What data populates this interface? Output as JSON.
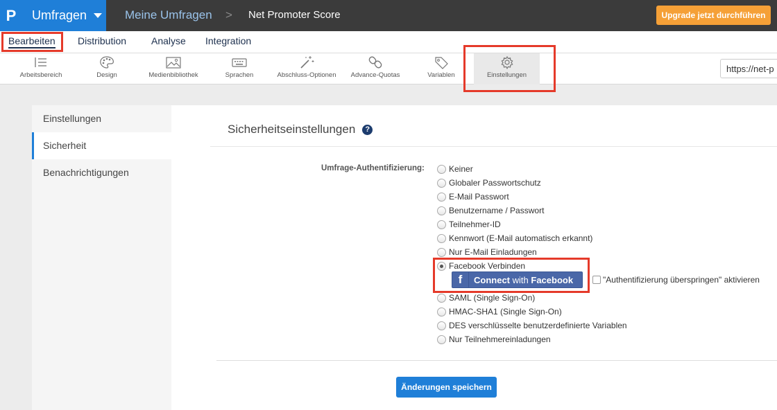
{
  "app": {
    "name": "Umfragen",
    "logo": "P"
  },
  "breadcrumb": {
    "parent": "Meine Umfragen",
    "separator": ">",
    "current": "Net Promoter Score"
  },
  "upgrade_label": "Upgrade jetzt durchführen",
  "nav_tabs": [
    {
      "label": "Bearbeiten",
      "active": true
    },
    {
      "label": "Distribution"
    },
    {
      "label": "Analyse"
    },
    {
      "label": "Integration"
    }
  ],
  "toolbar": {
    "items": [
      {
        "label": "Arbeitsbereich",
        "icon": "list-icon"
      },
      {
        "label": "Design",
        "icon": "palette-icon"
      },
      {
        "label": "Medienbibliothek",
        "icon": "image-icon"
      },
      {
        "label": "Sprachen",
        "icon": "keyboard-icon"
      },
      {
        "label": "Abschluss-Optionen",
        "icon": "magic-wand-icon"
      },
      {
        "label": "Advance-Quotas",
        "icon": "link-icon"
      },
      {
        "label": "Variablen",
        "icon": "tag-icon"
      },
      {
        "label": "Einstellungen",
        "icon": "gear-icon",
        "active": true
      }
    ],
    "url": "https://net-p"
  },
  "sidebar": {
    "items": [
      {
        "label": "Einstellungen"
      },
      {
        "label": "Sicherheit",
        "active": true
      },
      {
        "label": "Benachrichtigungen"
      }
    ]
  },
  "main": {
    "title": "Sicherheitseinstellungen",
    "help": "?",
    "auth_label": "Umfrage-Authentifizierung:",
    "options": [
      "Keiner",
      "Globaler Passwortschutz",
      "E-Mail Passwort",
      "Benutzername / Passwort",
      "Teilnehmer-ID",
      "Kennwort (E-Mail automatisch erkannt)",
      "Nur E-Mail Einladungen",
      "Facebook Verbinden",
      "SAML (Single Sign-On)",
      "HMAC-SHA1 (Single Sign-On)",
      "DES verschlüsselte benutzerdefinierte Variablen",
      "Nur Teilnehmereinladungen"
    ],
    "selected_option": "Facebook Verbinden",
    "facebook_button": {
      "f": "f",
      "connect": "Connect",
      "with": "with",
      "facebook": "Facebook"
    },
    "skip_auth_label": "\"Authentifizierung überspringen\" aktivieren",
    "save_label": "Änderungen speichern"
  },
  "colors": {
    "topbar": "#3b3b3b",
    "brand_blue": "#1f7fd8",
    "upgrade_orange": "#f5a037",
    "highlight_red": "#e53a2a",
    "facebook_blue": "#4a67a8"
  }
}
